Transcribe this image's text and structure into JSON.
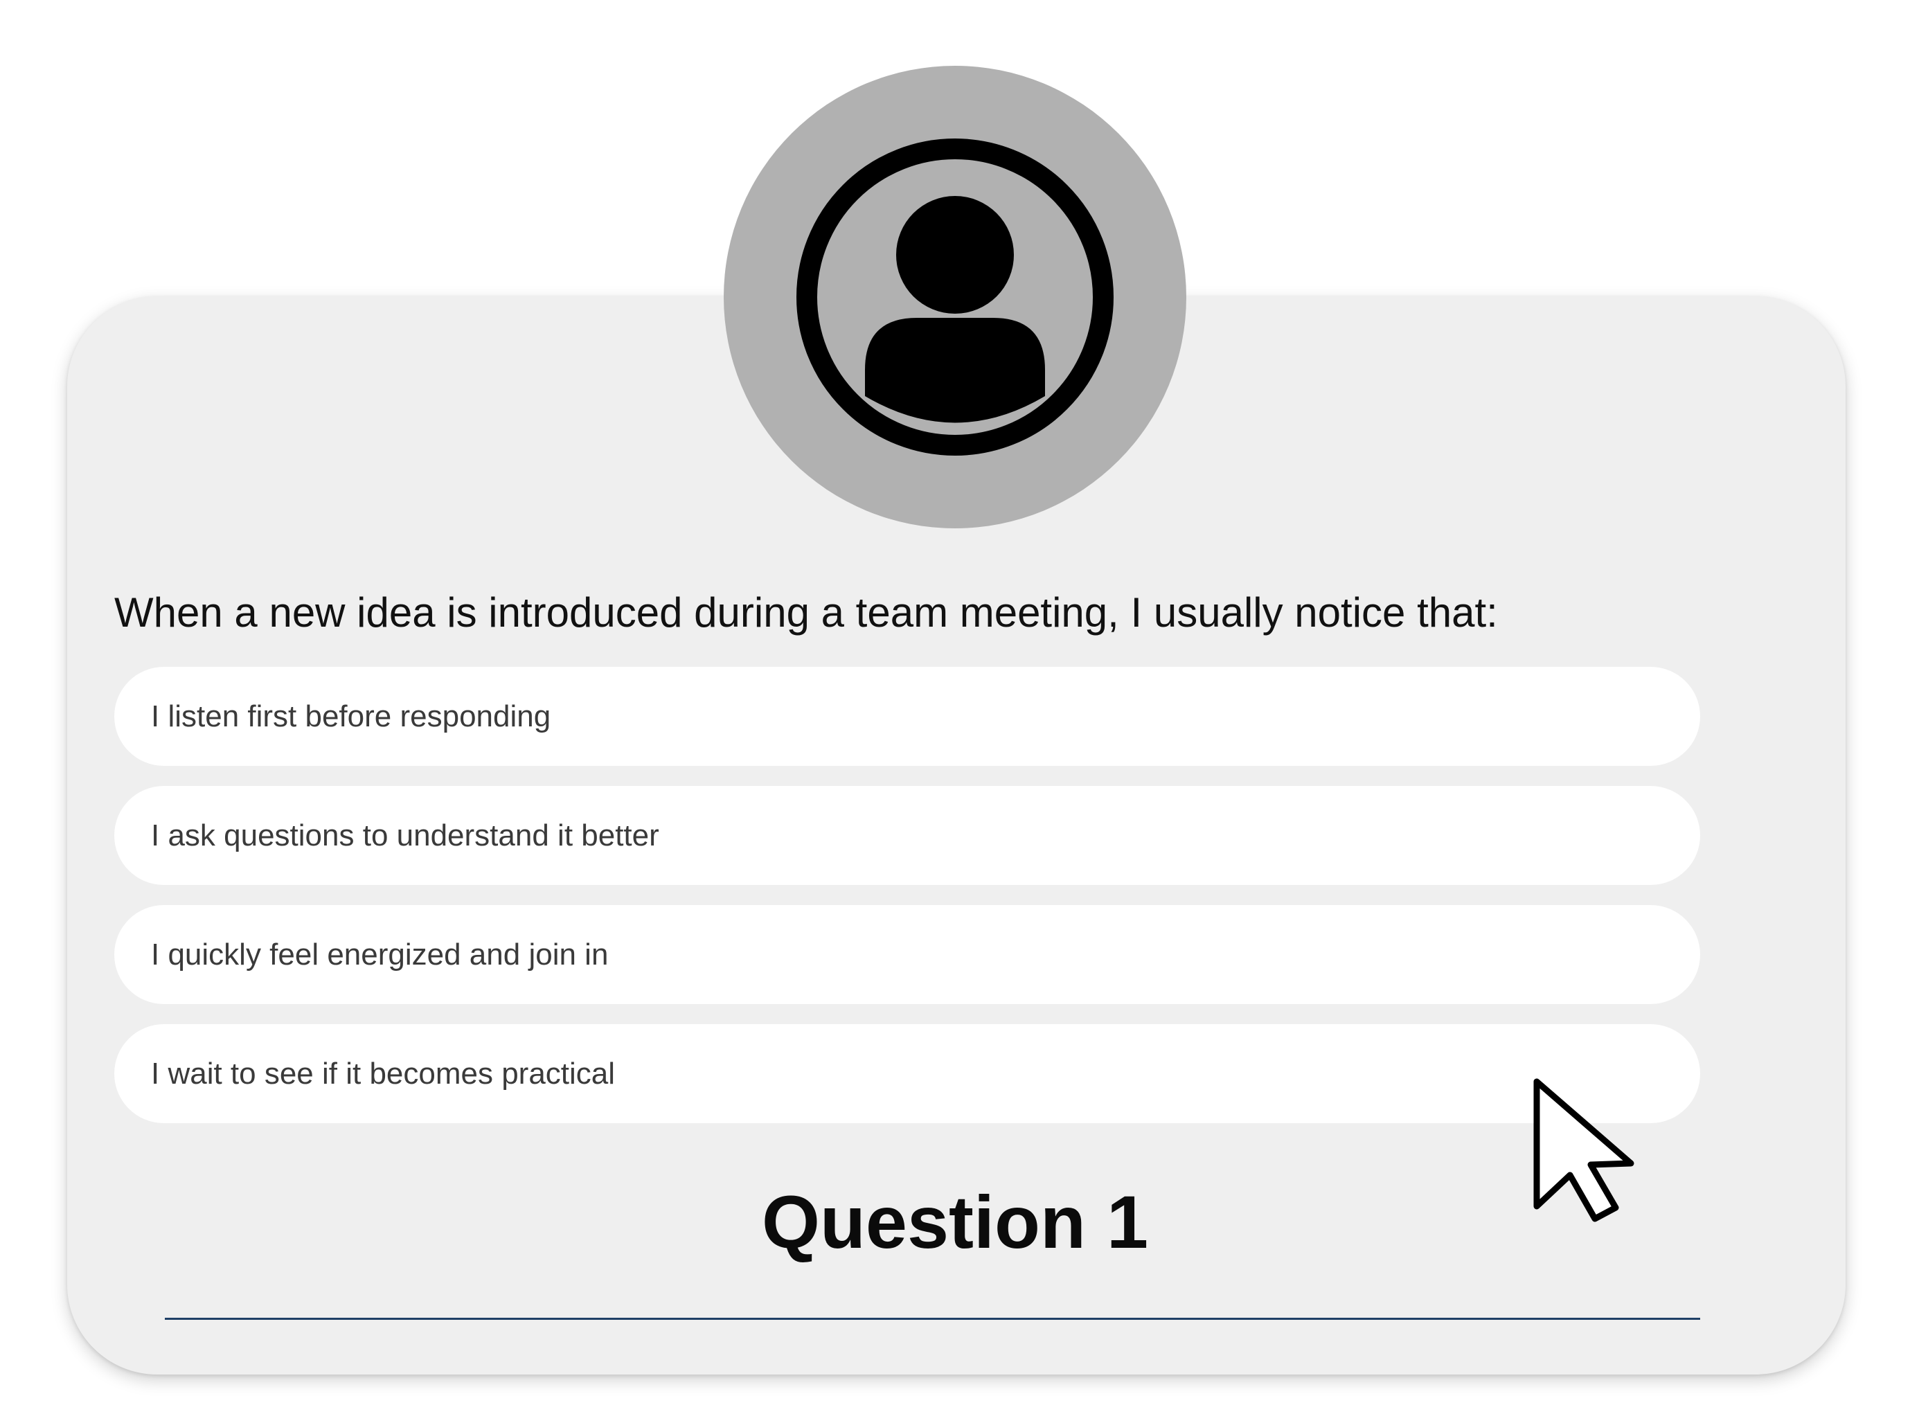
{
  "quiz": {
    "question_text": "When a new idea is introduced during a team meeting, I usually notice that:",
    "options": [
      {
        "label": "I listen first before responding"
      },
      {
        "label": "I ask questions to understand it better"
      },
      {
        "label": "I quickly feel energized and join in"
      },
      {
        "label": "I wait to see if it becomes practical"
      }
    ],
    "question_title": "Question 1"
  },
  "icons": {
    "avatar": "user-avatar-icon",
    "cursor": "mouse-pointer-icon"
  },
  "colors": {
    "card_background": "#efefef",
    "avatar_background": "#b1b1b1",
    "option_background": "#ffffff",
    "divider": "#1f3f66",
    "text": "#111111"
  }
}
